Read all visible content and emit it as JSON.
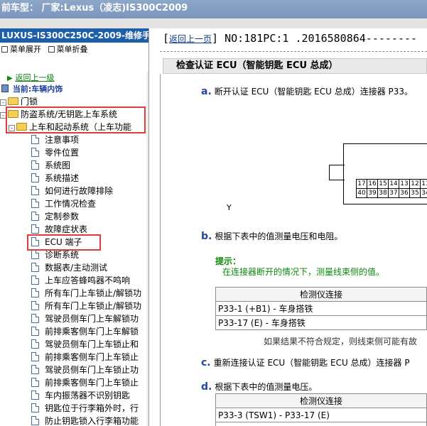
{
  "window": {
    "title": "前车型：  厂家:Lexus（凌志)IS300C2009"
  },
  "left": {
    "manual_title": "LUXUS-IS300C250C-2009-维修手册",
    "menu_expand": "菜单展开",
    "menu_collapse": "菜单折叠",
    "back_link": "返回上一级",
    "current": "当前:车辆内饰",
    "tree": [
      {
        "label": "门锁"
      },
      {
        "label": "防盗系统/无钥匙上车系统"
      },
      {
        "label": "上车和起动系统（上车功能"
      },
      {
        "label": "注意事项"
      },
      {
        "label": "零件位置"
      },
      {
        "label": "系统图"
      },
      {
        "label": "系统描述"
      },
      {
        "label": "如何进行故障排除"
      },
      {
        "label": "工作情况检查"
      },
      {
        "label": "定制参数"
      },
      {
        "label": "故障症状表"
      },
      {
        "label": "ECU 端子"
      },
      {
        "label": "诊断系统"
      },
      {
        "label": "数据表/主动测试"
      },
      {
        "label": "上车应答蜂鸣器不鸣响"
      },
      {
        "label": "所有车门上车锁止/解锁功"
      },
      {
        "label": "所有车门上车锁止/解锁功"
      },
      {
        "label": "驾驶员侧车门上车解锁功"
      },
      {
        "label": "前排乘客侧车门上车解锁"
      },
      {
        "label": "驾驶员侧车门上车锁止和"
      },
      {
        "label": "前排乘客侧车门上车锁止"
      },
      {
        "label": "驾驶员侧车门上车锁止功"
      },
      {
        "label": "前排乘客侧车门上车锁止"
      },
      {
        "label": "车内振荡器不识别钥匙"
      },
      {
        "label": "钥匙位于行李箱外时，行"
      },
      {
        "label": "防止钥匙锁入行李箱功能"
      }
    ]
  },
  "right": {
    "back_link": "返回上一页",
    "doc_no": "NO:181PC:1 .2016580864--------",
    "section_title": "检查认证 ECU（智能钥匙 ECU 总成）",
    "step_a": {
      "letter": "a.",
      "text": "断开认证 ECU（智能钥匙 ECU 总成）连接器 P33。"
    },
    "connector": {
      "row1": [
        "17",
        "16",
        "15",
        "14",
        "13",
        "12",
        "11"
      ],
      "row2": [
        "40",
        "39",
        "38",
        "37",
        "36",
        "35",
        "34"
      ],
      "label": "Y"
    },
    "step_b": {
      "letter": "b.",
      "text": "根据下表中的值测量电压和电阻。"
    },
    "hint_title": "提示：",
    "hint_text": "在连接器断开的情况下，测量线束侧的值。",
    "table1": {
      "header": "检测仪连接",
      "rows": [
        "P33-1 (+B1) - 车身搭铁",
        "P33-17 (E) - 车身搭铁"
      ]
    },
    "note": "如果结果不符合规定，则线束侧可能有故",
    "step_c": {
      "letter": "c.",
      "text": "重新连接认证 ECU（智能钥匙 ECU 总成）连接器 P"
    },
    "step_d": {
      "letter": "d.",
      "text": "根据下表中的值测量电压。"
    },
    "table2": {
      "header": "检测仪连接",
      "rows": [
        "P33-3 (TSW1) - P33-17 (E)"
      ]
    }
  }
}
